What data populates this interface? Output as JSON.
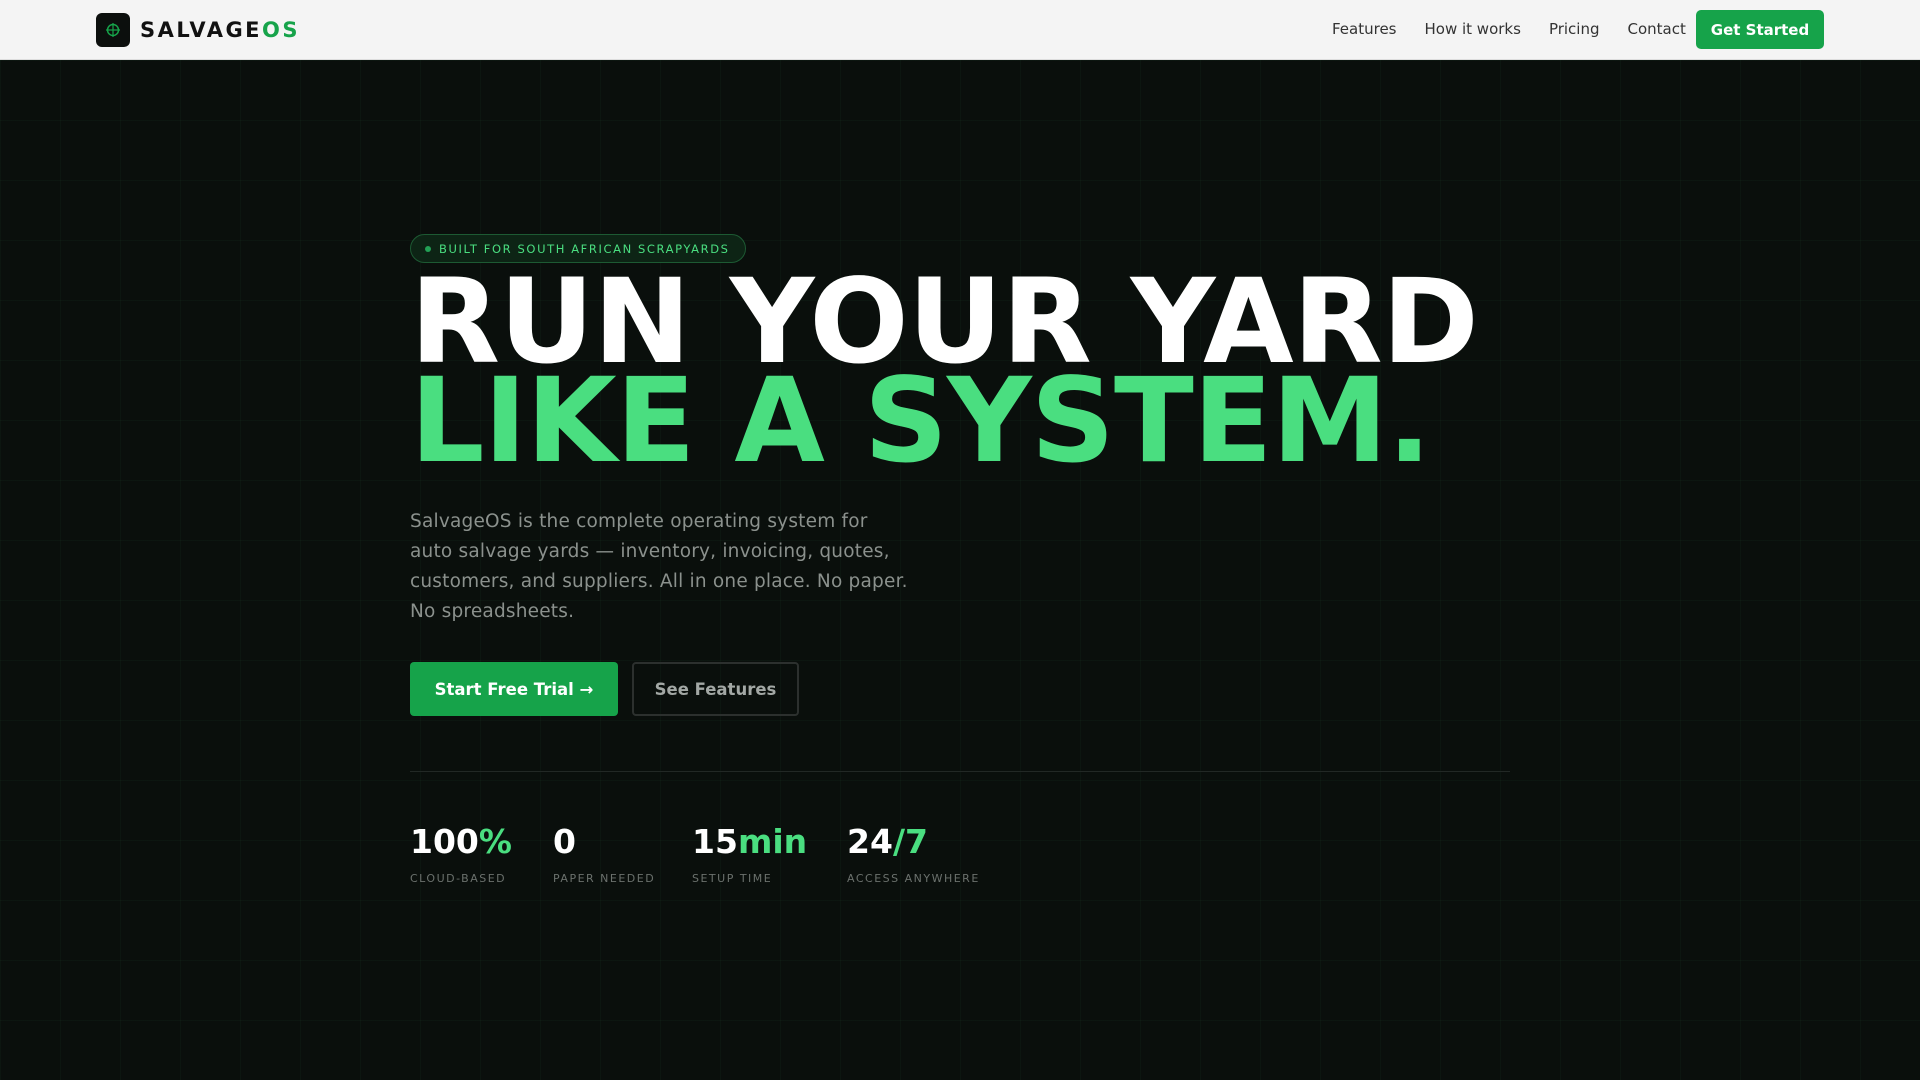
{
  "nav": {
    "brand_main": "SALVAGE",
    "brand_accent": "OS",
    "links": [
      "Features",
      "How it works",
      "Pricing",
      "Contact"
    ],
    "cta": "Get Started"
  },
  "hero": {
    "badge": "BUILT FOR SOUTH AFRICAN SCRAPYARDS",
    "title_line1": "RUN YOUR YARD",
    "title_line2": "LIKE A SYSTEM.",
    "description": "SalvageOS is the complete operating system for auto salvage yards — inventory, invoicing, quotes, customers, and suppliers. All in one place. No paper. No spreadsheets.",
    "primary_button": "Start Free Trial →",
    "secondary_button": "See Features"
  },
  "stats": [
    {
      "value": "100",
      "accent": "%",
      "label": "CLOUD-BASED"
    },
    {
      "value": "0",
      "accent": "",
      "label": "PAPER NEEDED"
    },
    {
      "value": "15",
      "accent": "min",
      "label": "SETUP TIME"
    },
    {
      "value": "24",
      "accent": "/7",
      "label": "ACCESS ANYWHERE"
    }
  ],
  "colors": {
    "accent": "#4ade80",
    "button": "#16a34a",
    "background": "#0a0f0c"
  }
}
